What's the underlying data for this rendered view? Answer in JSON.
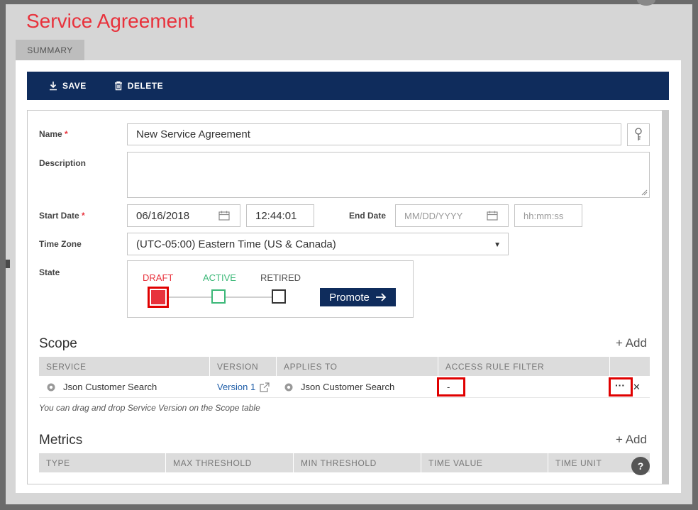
{
  "modal": {
    "title": "Service Agreement",
    "tab": "SUMMARY"
  },
  "toolbar": {
    "save_label": "SAVE",
    "delete_label": "DELETE"
  },
  "form": {
    "name_label": "Name",
    "name_value": "New Service Agreement",
    "description_label": "Description",
    "description_value": "",
    "start_date_label": "Start Date",
    "start_date_value": "06/16/2018",
    "start_time_value": "12:44:01",
    "end_date_label": "End Date",
    "end_date_placeholder": "MM/DD/YYYY",
    "end_time_placeholder": "hh:mm:ss",
    "timezone_label": "Time Zone",
    "timezone_value": "(UTC-05:00) Eastern Time (US & Canada)",
    "state_label": "State",
    "required_marker": "*"
  },
  "state": {
    "steps": [
      "DRAFT",
      "ACTIVE",
      "RETIRED"
    ],
    "current": "DRAFT",
    "colors": {
      "draft": "#e8323c",
      "active": "#3cb878",
      "retired": "#333333"
    },
    "promote_label": "Promote"
  },
  "scope": {
    "title": "Scope",
    "add_label": "+ Add",
    "columns": [
      "SERVICE",
      "VERSION",
      "APPLIES TO",
      "ACCESS RULE FILTER"
    ],
    "rows": [
      {
        "service": "Json Customer Search",
        "version": "Version 1",
        "applies_to": "Json Customer Search",
        "access_rule_filter": "-",
        "more": "···",
        "remove": "✕"
      }
    ],
    "hint": "You can drag and drop Service Version on the Scope table"
  },
  "metrics": {
    "title": "Metrics",
    "add_label": "+ Add",
    "columns": [
      "TYPE",
      "MAX THRESHOLD",
      "MIN THRESHOLD",
      "TIME VALUE",
      "TIME UNIT"
    ]
  },
  "help": {
    "label": "?"
  },
  "colors": {
    "accent_red": "#e8323c",
    "navy": "#0f2c5c",
    "highlight": "#e00000"
  }
}
